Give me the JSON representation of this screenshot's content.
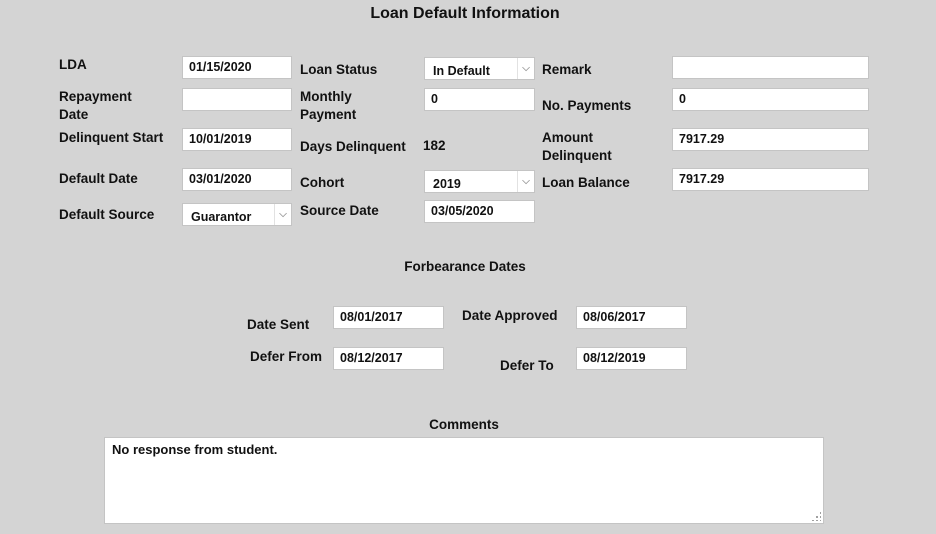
{
  "title": "Loan Default Information",
  "fields": {
    "lda": {
      "label": "LDA",
      "value": "01/15/2020"
    },
    "repayment_date": {
      "label": "Repayment\nDate",
      "value": ""
    },
    "delinquent_start": {
      "label": "Delinquent Start",
      "value": "10/01/2019"
    },
    "default_date": {
      "label": "Default Date",
      "value": "03/01/2020"
    },
    "default_source": {
      "label": "Default Source",
      "value": "Guarantor"
    },
    "loan_status": {
      "label": "Loan Status",
      "value": "In Default"
    },
    "monthly_payment": {
      "label": "Monthly\nPayment",
      "value": "0"
    },
    "days_delinquent": {
      "label": "Days Delinquent",
      "value": "182"
    },
    "cohort": {
      "label": "Cohort",
      "value": "2019"
    },
    "source_date": {
      "label": "Source Date",
      "value": "03/05/2020"
    },
    "remark": {
      "label": "Remark",
      "value": ""
    },
    "no_payments": {
      "label": "No. Payments",
      "value": "0"
    },
    "amount_delinquent": {
      "label": "Amount\nDelinquent",
      "value": "7917.29"
    },
    "loan_balance": {
      "label": "Loan Balance",
      "value": "7917.29"
    }
  },
  "forbearance": {
    "heading": "Forbearance Dates",
    "date_sent": {
      "label": "Date Sent",
      "value": "08/01/2017"
    },
    "date_approved": {
      "label": "Date Approved",
      "value": "08/06/2017"
    },
    "defer_from": {
      "label": "Defer From",
      "value": "08/12/2017"
    },
    "defer_to": {
      "label": "Defer To",
      "value": "08/12/2019"
    }
  },
  "comments": {
    "heading": "Comments",
    "value": "No response from student."
  },
  "icons": {
    "dropdown": "chevron-down-icon",
    "resize": "resize-grip-icon"
  }
}
